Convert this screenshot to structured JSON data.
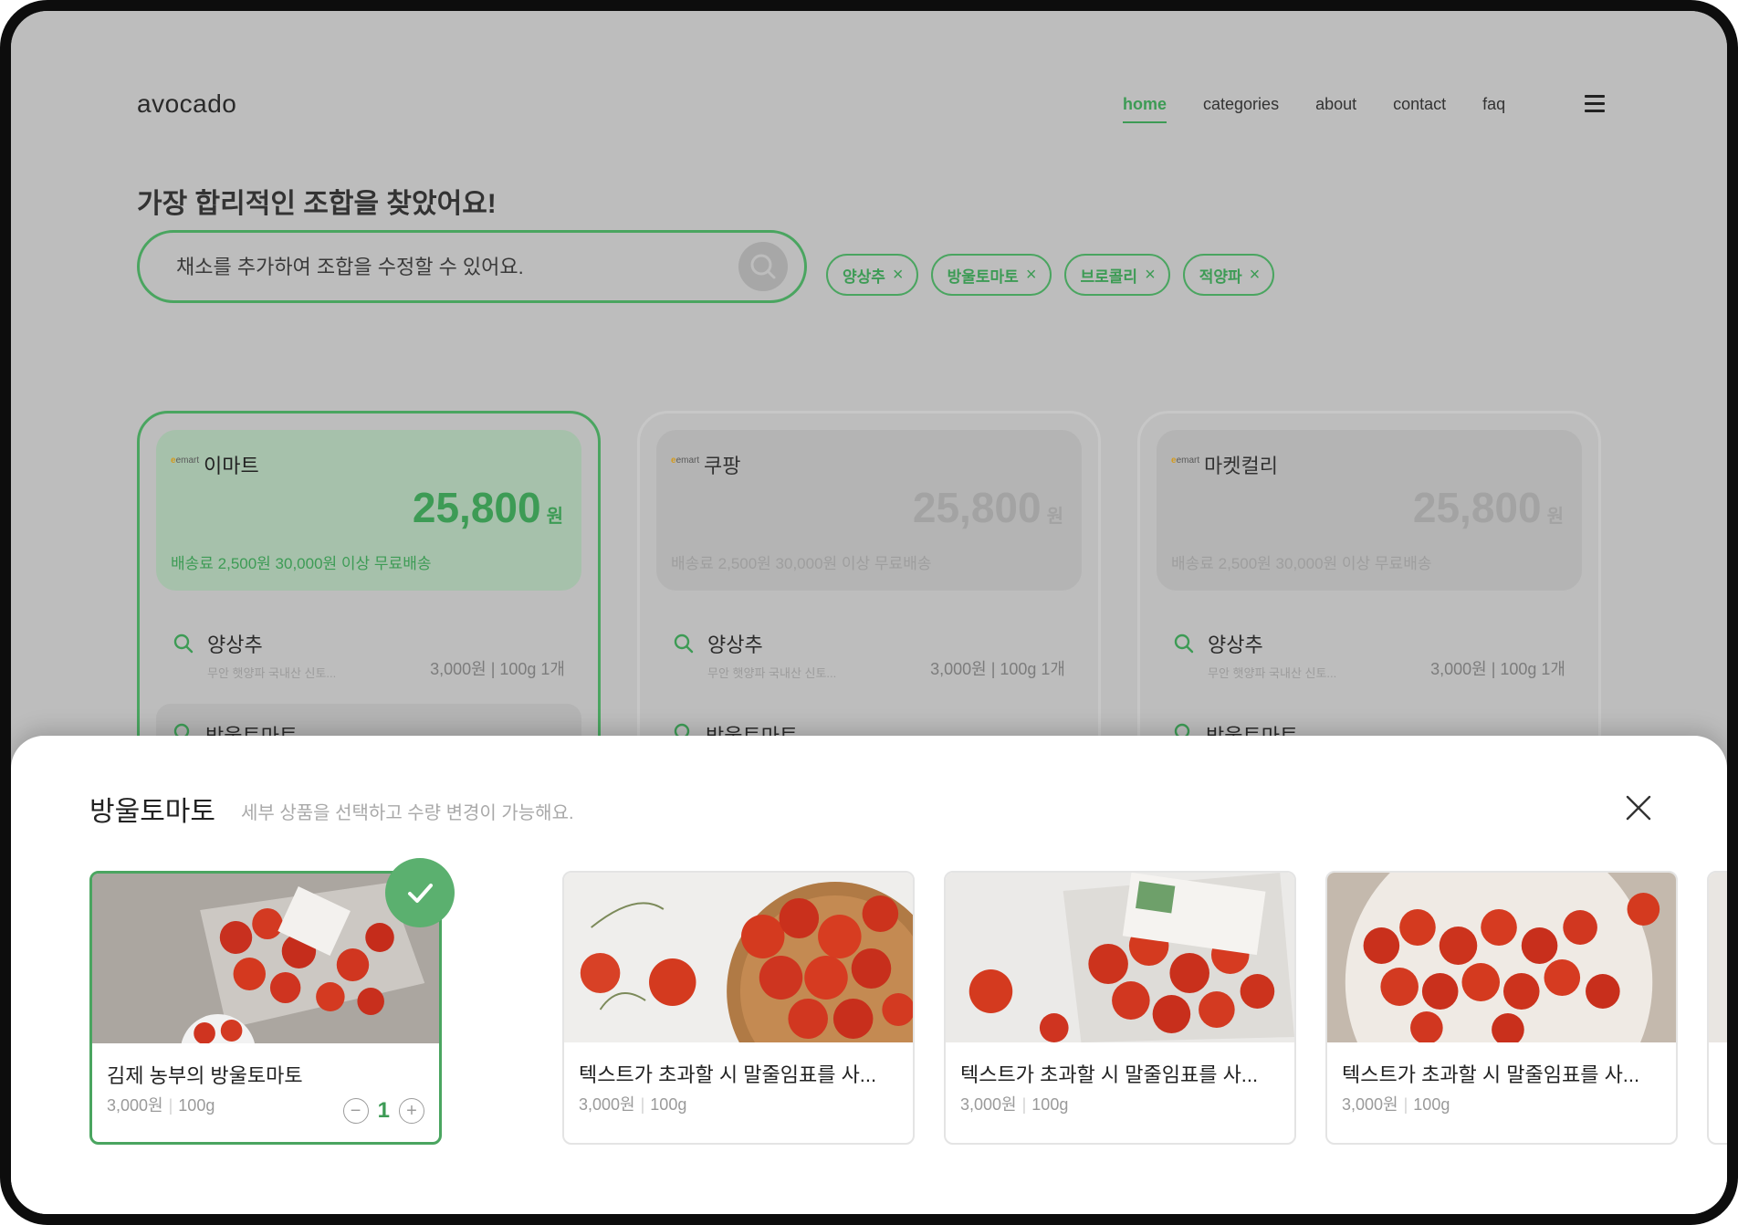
{
  "header": {
    "logo": "avocado",
    "nav": [
      "home",
      "categories",
      "about",
      "contact",
      "faq"
    ],
    "active_nav": "home"
  },
  "headline": "가장 합리적인 조합을 찾았어요!",
  "search": {
    "placeholder": "채소를 추가하여 조합을 수정할 수 있어요."
  },
  "chips": [
    "양상추",
    "방울토마토",
    "브로콜리",
    "적양파"
  ],
  "stores": [
    {
      "logo": "emart",
      "name": "이마트",
      "price": "25,800",
      "currency": "원",
      "shipping": "배송료 2,500원   30,000원 이상 무료배송",
      "item": {
        "name": "양상추",
        "desc": "무안 햇양파 국내산 신토...",
        "price": "3,000원 | 100g 1개"
      },
      "item2": "방울토마토"
    },
    {
      "logo": "emart",
      "name": "쿠팡",
      "price": "25,800",
      "currency": "원",
      "shipping": "배송료 2,500원   30,000원 이상 무료배송",
      "item": {
        "name": "양상추",
        "desc": "무안 햇양파 국내산 신토...",
        "price": "3,000원 | 100g 1개"
      },
      "item2": "방울토마토"
    },
    {
      "logo": "emart",
      "name": "마켓컬리",
      "price": "25,800",
      "currency": "원",
      "shipping": "배송료 2,500원   30,000원 이상 무료배송",
      "item": {
        "name": "양상추",
        "desc": "무안 햇양파 국내산 신토...",
        "price": "3,000원 | 100g 1개"
      },
      "item2": "방울토마토"
    }
  ],
  "sheet": {
    "title": "방울토마토",
    "subtitle": "세부 상품을 선택하고 수량 변경이 가능해요.",
    "products": [
      {
        "name": "김제 농부의 방울토마토",
        "price": "3,000원",
        "weight": "100g",
        "qty": "1",
        "selected": true
      },
      {
        "name": "텍스트가 초과할 시 말줄임표를 사...",
        "price": "3,000원",
        "weight": "100g"
      },
      {
        "name": "텍스트가 초과할 시 말줄임표를 사...",
        "price": "3,000원",
        "weight": "100g"
      },
      {
        "name": "텍스트가 초과할 시 말줄임표를 사...",
        "price": "3,000원",
        "weight": "100g"
      }
    ]
  },
  "colors": {
    "accent": "#3d9b55",
    "tomato": "#d9381e",
    "overlay": "#bdbdbd"
  }
}
